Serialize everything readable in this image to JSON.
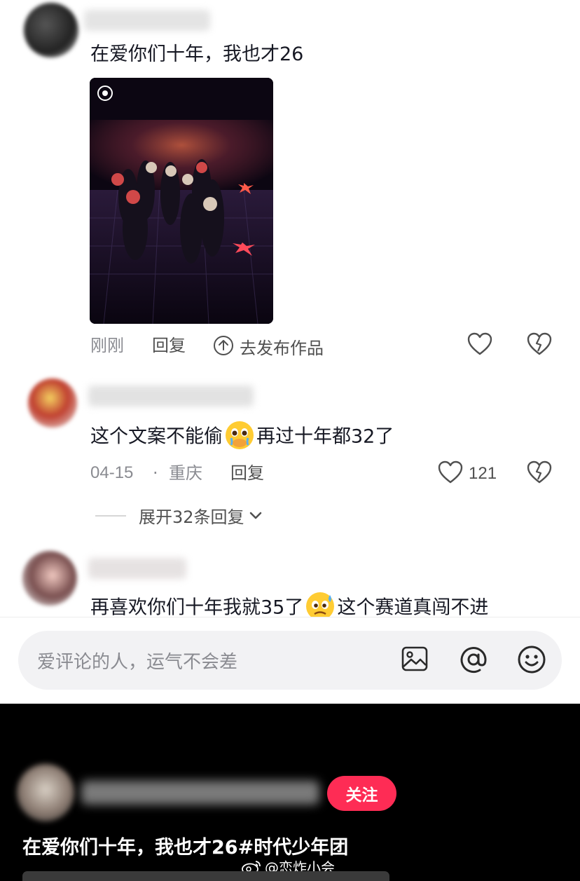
{
  "comments": [
    {
      "text": "在爱你们十年，我也才26",
      "time": "刚刚",
      "reply": "回复",
      "publish": "去发布作品"
    },
    {
      "text_a": "这个文案不能偷",
      "text_b": "再过十年都32了",
      "date": "04-15",
      "dot": "·",
      "location": "重庆",
      "reply": "回复",
      "likes": "121",
      "expand": "展开32条回复"
    },
    {
      "text_a": "再喜欢你们十年我就35了",
      "text_b": "这个赛道真闯不进"
    }
  ],
  "input": {
    "placeholder": "爱评论的人，运气不会差"
  },
  "video": {
    "follow": "关注",
    "caption": "在爱你们十年，我也才26",
    "hashtag": "#时代少年团",
    "watermark": "@恋炸小会"
  },
  "colors": {
    "accent": "#fe2c55",
    "text": "#161823",
    "muted": "#8a8b91"
  }
}
